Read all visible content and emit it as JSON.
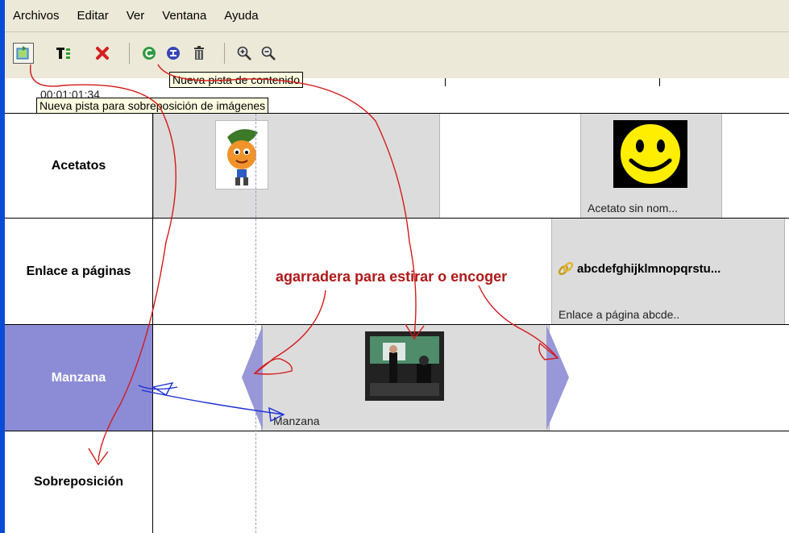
{
  "menubar": {
    "items": [
      "Archivos",
      "Editar",
      "Ver",
      "Ventana",
      "Ayuda"
    ]
  },
  "toolbar": {
    "buttons": [
      {
        "name": "new-overlay-track-icon"
      },
      {
        "name": "text-track-icon"
      },
      {
        "name": "delete-x-icon"
      },
      {
        "name": "new-content-track-icon"
      },
      {
        "name": "info-icon"
      },
      {
        "name": "trash-icon"
      },
      {
        "name": "zoom-in-icon"
      },
      {
        "name": "zoom-out-icon"
      }
    ]
  },
  "ruler": {
    "time": "00:01:01:34"
  },
  "tooltips": {
    "content_track": "Nueva pista de contenido",
    "overlay_track": "Nueva pista para sobreposición de imágenes"
  },
  "tracks": [
    {
      "label": "Acetatos"
    },
    {
      "label": "Enlace a páginas"
    },
    {
      "label": "Manzana"
    },
    {
      "label": "Sobreposición"
    }
  ],
  "clips": {
    "acetato_caption": "Acetato sin nom...",
    "link_title": "abcdefghijklmnopqrstu...",
    "link_caption": "Enlace a página abcde..",
    "video_caption": "Manzana"
  },
  "annotation": {
    "text": "agarradera para estirar o encoger"
  },
  "colors": {
    "selected_track": "#8c8cd6",
    "annotation_red": "#b01818",
    "annotation_blue": "#1a2fd6"
  }
}
